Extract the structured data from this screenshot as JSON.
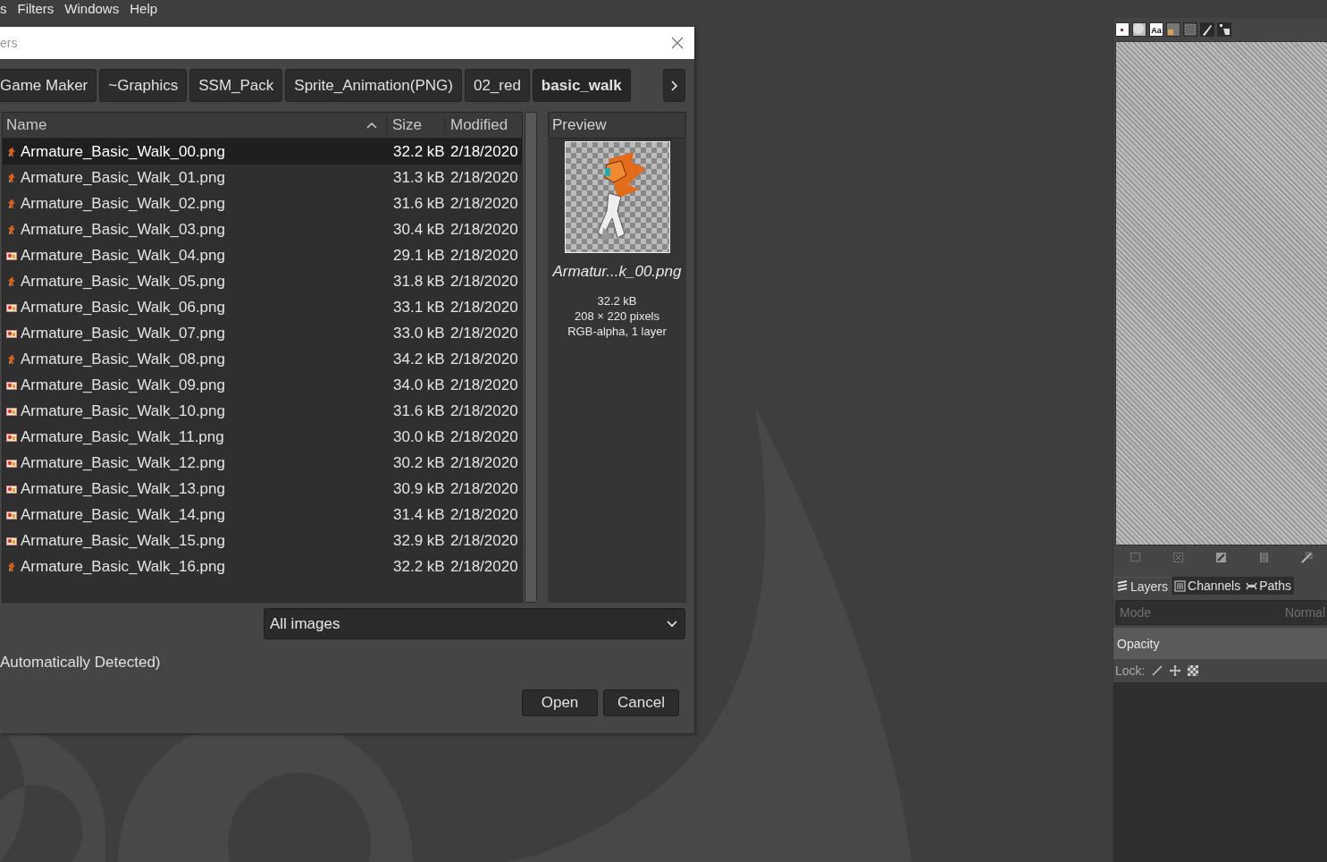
{
  "menubar": [
    "s",
    "Filters",
    "Windows",
    "Help"
  ],
  "dialog": {
    "title": "ers",
    "path_buttons": [
      {
        "label": "Game Maker",
        "selected": false
      },
      {
        "label": "~Graphics",
        "selected": false
      },
      {
        "label": "SSM_Pack",
        "selected": false
      },
      {
        "label": "Sprite_Animation(PNG)",
        "selected": false
      },
      {
        "label": "02_red",
        "selected": false
      },
      {
        "label": "basic_walk",
        "selected": true
      }
    ],
    "columns": {
      "name": "Name",
      "size": "Size",
      "modified": "Modified"
    },
    "files": [
      {
        "name": "Armature_Basic_Walk_00.png",
        "size": "32.2 kB",
        "modified": "2/18/2020",
        "kind": "sprite",
        "selected": true
      },
      {
        "name": "Armature_Basic_Walk_01.png",
        "size": "31.3 kB",
        "modified": "2/18/2020",
        "kind": "sprite",
        "selected": false
      },
      {
        "name": "Armature_Basic_Walk_02.png",
        "size": "31.6 kB",
        "modified": "2/18/2020",
        "kind": "sprite",
        "selected": false
      },
      {
        "name": "Armature_Basic_Walk_03.png",
        "size": "30.4 kB",
        "modified": "2/18/2020",
        "kind": "sprite",
        "selected": false
      },
      {
        "name": "Armature_Basic_Walk_04.png",
        "size": "29.1 kB",
        "modified": "2/18/2020",
        "kind": "image",
        "selected": false
      },
      {
        "name": "Armature_Basic_Walk_05.png",
        "size": "31.8 kB",
        "modified": "2/18/2020",
        "kind": "sprite",
        "selected": false
      },
      {
        "name": "Armature_Basic_Walk_06.png",
        "size": "33.1 kB",
        "modified": "2/18/2020",
        "kind": "image",
        "selected": false
      },
      {
        "name": "Armature_Basic_Walk_07.png",
        "size": "33.0 kB",
        "modified": "2/18/2020",
        "kind": "image",
        "selected": false
      },
      {
        "name": "Armature_Basic_Walk_08.png",
        "size": "34.2 kB",
        "modified": "2/18/2020",
        "kind": "sprite",
        "selected": false
      },
      {
        "name": "Armature_Basic_Walk_09.png",
        "size": "34.0 kB",
        "modified": "2/18/2020",
        "kind": "image",
        "selected": false
      },
      {
        "name": "Armature_Basic_Walk_10.png",
        "size": "31.6 kB",
        "modified": "2/18/2020",
        "kind": "image",
        "selected": false
      },
      {
        "name": "Armature_Basic_Walk_11.png",
        "size": "30.0 kB",
        "modified": "2/18/2020",
        "kind": "image",
        "selected": false
      },
      {
        "name": "Armature_Basic_Walk_12.png",
        "size": "30.2 kB",
        "modified": "2/18/2020",
        "kind": "image",
        "selected": false
      },
      {
        "name": "Armature_Basic_Walk_13.png",
        "size": "30.9 kB",
        "modified": "2/18/2020",
        "kind": "image",
        "selected": false
      },
      {
        "name": "Armature_Basic_Walk_14.png",
        "size": "31.4 kB",
        "modified": "2/18/2020",
        "kind": "image",
        "selected": false
      },
      {
        "name": "Armature_Basic_Walk_15.png",
        "size": "32.9 kB",
        "modified": "2/18/2020",
        "kind": "image",
        "selected": false
      },
      {
        "name": "Armature_Basic_Walk_16.png",
        "size": "32.2 kB",
        "modified": "2/18/2020",
        "kind": "sprite",
        "selected": false
      }
    ],
    "preview": {
      "heading": "Preview",
      "filename": "Armatur...k_00.png",
      "size": "32.2 kB",
      "dimensions": "208 × 220 pixels",
      "info": "RGB-alpha, 1 layer"
    },
    "filter": "All images",
    "file_type": "Automatically Detected)",
    "buttons": [
      "Open",
      "Cancel"
    ]
  },
  "dock": {
    "font_glyph": "Aa",
    "tabs": [
      {
        "label": "Layers",
        "selected": true
      },
      {
        "label": "Channels",
        "selected": false
      },
      {
        "label": "Paths",
        "selected": false
      }
    ],
    "mode_label": "Mode",
    "mode_value": "Normal",
    "opacity": {
      "label": "Opacity",
      "level": 1
    },
    "lock_label": "Lock:"
  }
}
